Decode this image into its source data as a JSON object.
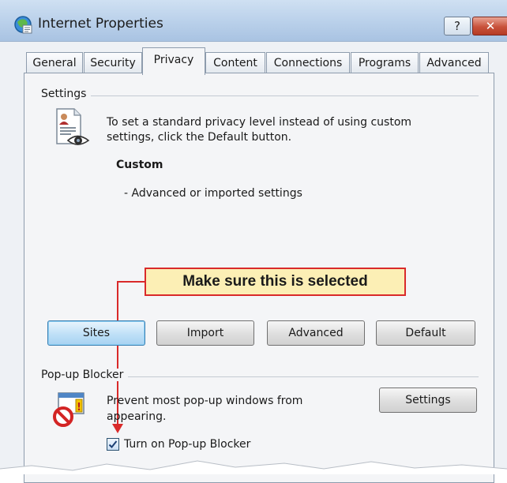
{
  "window": {
    "title": "Internet Properties",
    "help_label": "?",
    "close_label": "✕"
  },
  "tabs": [
    {
      "label": "General"
    },
    {
      "label": "Security"
    },
    {
      "label": "Privacy"
    },
    {
      "label": "Content"
    },
    {
      "label": "Connections"
    },
    {
      "label": "Programs"
    },
    {
      "label": "Advanced"
    }
  ],
  "active_tab": "Privacy",
  "settings": {
    "group_label": "Settings",
    "description_line1": "To set a standard privacy level instead of using custom",
    "description_line2": "settings, click the Default button.",
    "level_title": "Custom",
    "level_detail": "- Advanced or imported settings",
    "buttons": {
      "sites": "Sites",
      "import": "Import",
      "advanced": "Advanced",
      "default": "Default"
    }
  },
  "popup_blocker": {
    "group_label": "Pop-up Blocker",
    "description_line1": "Prevent most pop-up windows from",
    "description_line2": "appearing.",
    "settings_button": "Settings",
    "checkbox_label": "Turn on Pop-up Blocker",
    "checkbox_checked": true
  },
  "callout": {
    "text": "Make sure this is selected"
  },
  "colors": {
    "callout_border": "#d92a2a",
    "callout_fill": "#fcefb5",
    "titlebar": "#b9d0ea"
  }
}
